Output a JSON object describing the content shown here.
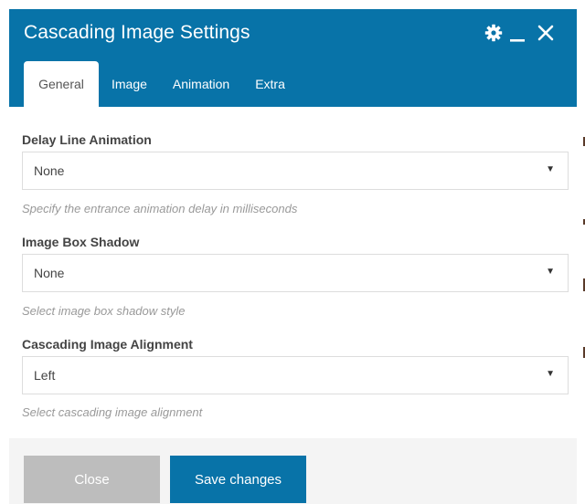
{
  "dialog": {
    "title": "Cascading Image Settings",
    "accent_color": "#0873a8",
    "icons": {
      "settings": "gear-icon",
      "minimize": "minimize-icon",
      "close": "close-icon"
    }
  },
  "tabs": [
    {
      "label": "General",
      "active": true
    },
    {
      "label": "Image",
      "active": false
    },
    {
      "label": "Animation",
      "active": false
    },
    {
      "label": "Extra",
      "active": false
    }
  ],
  "fields": [
    {
      "label": "Delay Line Animation",
      "value": "None",
      "help": "Specify the entrance animation delay in milliseconds"
    },
    {
      "label": "Image Box Shadow",
      "value": "None",
      "help": "Select image box shadow style"
    },
    {
      "label": "Cascading Image Alignment",
      "value": "Left",
      "help": "Select cascading image alignment"
    }
  ],
  "footer": {
    "close_label": "Close",
    "save_label": "Save changes",
    "close_color": "#bdbdbd",
    "save_color": "#0873a8"
  },
  "select_arrow_glyph": "▼"
}
